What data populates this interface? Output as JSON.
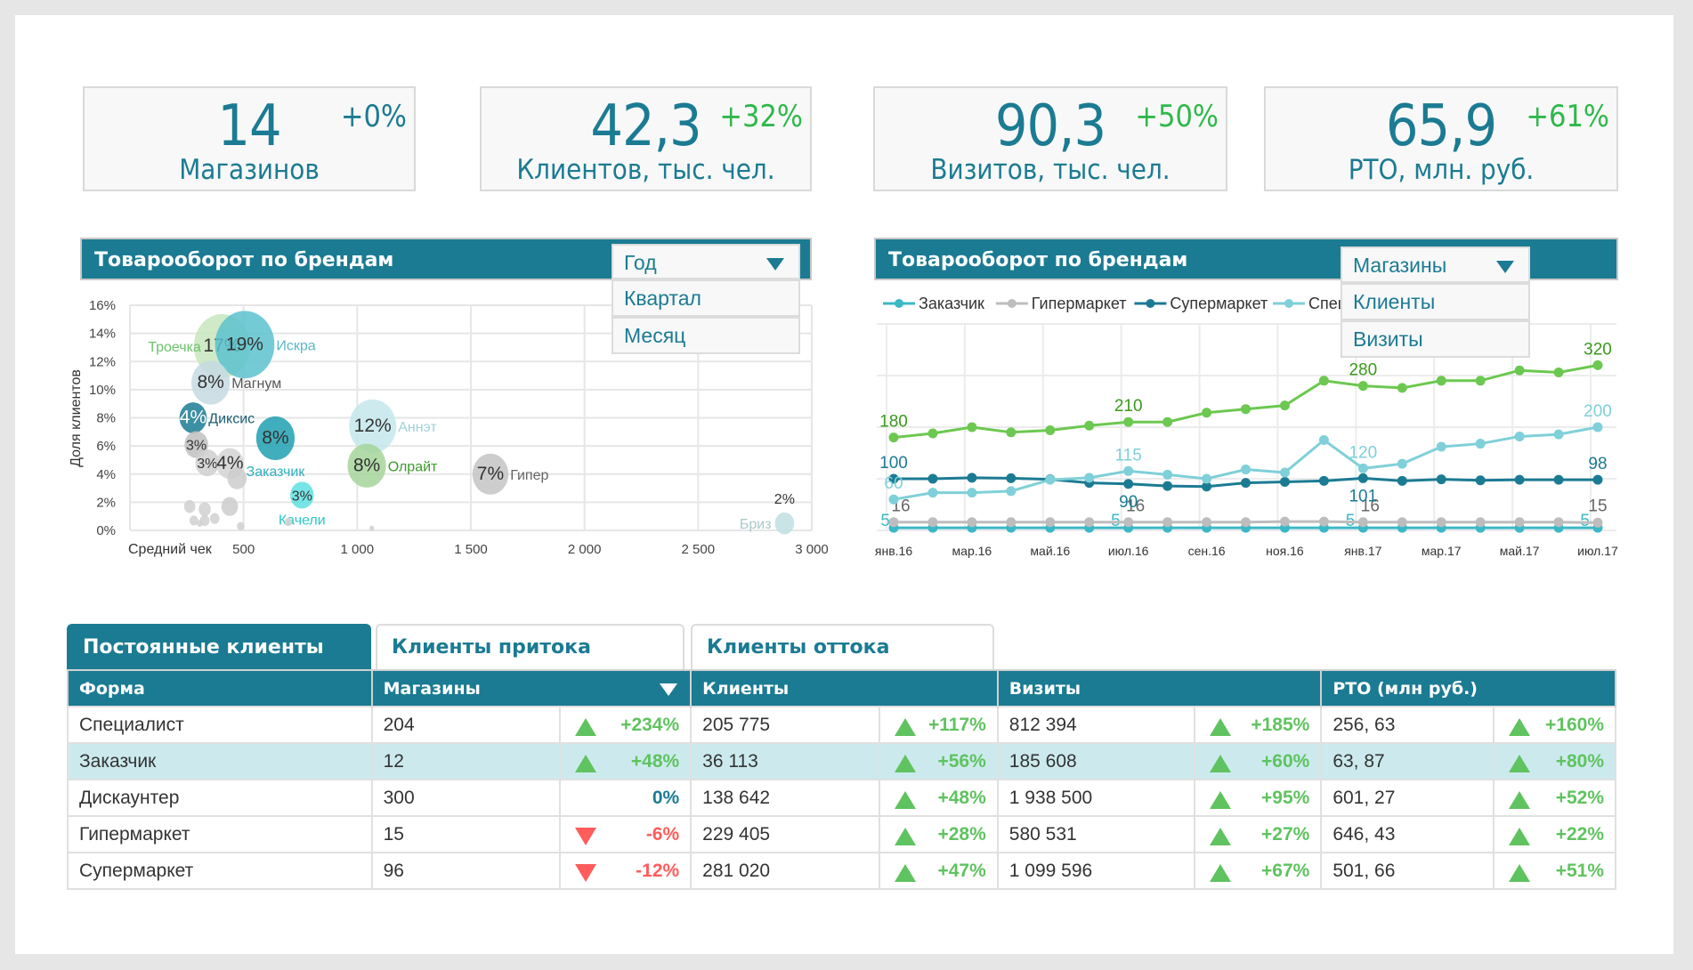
{
  "kpis": [
    {
      "value": "14",
      "change": "+0%",
      "label": "Магазинов",
      "change_color": "#1b7b93"
    },
    {
      "value": "42,3",
      "change": "+32%",
      "label": "Клиентов, тыс. чел.",
      "change_color": "#2fb84a"
    },
    {
      "value": "90,3",
      "change": "+50%",
      "label": "Визитов, тыс. чел.",
      "change_color": "#2fb84a"
    },
    {
      "value": "65,9",
      "change": "+61%",
      "label": "РТО, млн. руб.",
      "change_color": "#2fb84a"
    }
  ],
  "left_panel": {
    "title": "Товарооборот по брендам",
    "dropdown": {
      "selected": "Год",
      "options": [
        "Квартал",
        "Месяц"
      ]
    }
  },
  "right_panel": {
    "title": "Товарооборот по брендам",
    "dropdown": {
      "selected": "Магазины",
      "options": [
        "Клиенты",
        "Визиты"
      ]
    }
  },
  "chart_data": [
    {
      "type": "scatter",
      "subtype": "bubble",
      "xlabel": "Средний чек",
      "ylabel": "Доля клиентов",
      "xlim": [
        0,
        3000
      ],
      "ylim": [
        0,
        16
      ],
      "x_ticks": [
        "500",
        "1 000",
        "1 500",
        "2 000",
        "2 500",
        "3 000"
      ],
      "x_tick_values": [
        500,
        1000,
        1500,
        2000,
        2500,
        3000
      ],
      "y_ticks": [
        "0%",
        "2%",
        "4%",
        "6%",
        "8%",
        "10%",
        "12%",
        "14%",
        "16%"
      ],
      "grid": true,
      "points": [
        {
          "name": "Троечка",
          "x": 405,
          "y": 13.1,
          "size": 17,
          "label": "17%",
          "color": "#c8e6bd",
          "label_color": "#6cc36c"
        },
        {
          "name": "Искра",
          "x": 505,
          "y": 13.2,
          "size": 19,
          "label": "19%",
          "color": "#5cc2cf",
          "label_color": "#5ab8c8"
        },
        {
          "name": "Магнум",
          "x": 355,
          "y": 10.5,
          "size": 8,
          "label": "8%",
          "color": "#c6d9e2",
          "label_color": "#555555"
        },
        {
          "name": "Диксис",
          "x": 278,
          "y": 8.0,
          "size": 4,
          "label": "4%",
          "color": "#1b7b93",
          "label_color": "#1b5f72"
        },
        {
          "name": "",
          "x": 292,
          "y": 6.1,
          "size": 3,
          "label": "3%",
          "color": "#c0c0c0",
          "label_color": "#555555"
        },
        {
          "name": "",
          "x": 340,
          "y": 4.8,
          "size": 3,
          "label": "3%",
          "color": "#cfcfcf",
          "label_color": "#555555"
        },
        {
          "name": "",
          "x": 440,
          "y": 4.75,
          "size": 4,
          "label": "4%",
          "color": "#d4d4d4",
          "label_color": "#555555"
        },
        {
          "name": "",
          "x": 471,
          "y": 3.7,
          "size": 2,
          "label": "",
          "color": "#cccccc",
          "label_color": "#555555"
        },
        {
          "name": "Заказчик",
          "x": 640,
          "y": 6.55,
          "size": 8,
          "label": "8%",
          "color": "#1ea0b0",
          "label_color": "#30b0c0"
        },
        {
          "name": "Аннэт",
          "x": 1068,
          "y": 7.4,
          "size": 12,
          "label": "12%",
          "color": "#c4e7ec",
          "label_color": "#9fd2da"
        },
        {
          "name": "Олрайт",
          "x": 1042,
          "y": 4.6,
          "size": 8,
          "label": "8%",
          "color": "#a6d59a",
          "label_color": "#3a9a2a"
        },
        {
          "name": "Гипер",
          "x": 1586,
          "y": 4.0,
          "size": 7,
          "label": "7%",
          "color": "#c4c4c4",
          "label_color": "#666666"
        },
        {
          "name": "Качели",
          "x": 757,
          "y": 2.5,
          "size": 3,
          "label": "3%",
          "color": "#5fe0e0",
          "label_color": "#2cc8c8"
        },
        {
          "name": "Бриз",
          "x": 2880,
          "y": 0.5,
          "size": 2,
          "label": "2%",
          "color": "#c0dfe2",
          "label_color": "#aac8cc"
        },
        {
          "name": "",
          "x": 263,
          "y": 1.7,
          "size": 0.7,
          "label": "",
          "color": "#d0d0d0",
          "label_color": "#555555"
        },
        {
          "name": "",
          "x": 329,
          "y": 1.5,
          "size": 0.8,
          "label": "",
          "color": "#d0d0d0",
          "label_color": "#555555"
        },
        {
          "name": "",
          "x": 439,
          "y": 1.7,
          "size": 1.5,
          "label": "",
          "color": "#cccccc",
          "label_color": "#555555"
        },
        {
          "name": "",
          "x": 281,
          "y": 0.7,
          "size": 0.4,
          "label": "",
          "color": "#d0d0d0",
          "label_color": "#555555"
        },
        {
          "name": "",
          "x": 329,
          "y": 0.7,
          "size": 0.5,
          "label": "",
          "color": "#d0d0d0",
          "label_color": "#555555"
        },
        {
          "name": "",
          "x": 373,
          "y": 0.85,
          "size": 0.5,
          "label": "",
          "color": "#d0d0d0",
          "label_color": "#555555"
        },
        {
          "name": "",
          "x": 307,
          "y": 0.5,
          "size": 0.2,
          "label": "",
          "color": "#d0d0d0",
          "label_color": "#555555"
        },
        {
          "name": "",
          "x": 487,
          "y": 0.3,
          "size": 0.3,
          "label": "",
          "color": "#d0d0d0",
          "label_color": "#555555"
        },
        {
          "name": "",
          "x": 697,
          "y": 0.6,
          "size": 0.3,
          "label": "",
          "color": "#d0d0d0",
          "label_color": "#555555"
        },
        {
          "name": "",
          "x": 1064,
          "y": 0.15,
          "size": 0.1,
          "label": "",
          "color": "#d0d0d0",
          "label_color": "#555555"
        }
      ]
    },
    {
      "type": "line",
      "ylim": [
        0,
        400
      ],
      "grid": true,
      "legend": "top",
      "x_tick_labels": [
        "янв.16",
        "мар.16",
        "май.16",
        "июл.16",
        "сен.16",
        "ноя.16",
        "янв.17",
        "мар.17",
        "май.17",
        "июл.17"
      ],
      "series": [
        {
          "name": "Заказчик",
          "color": "#3bb8c6",
          "values": [
            5,
            5,
            5,
            5,
            5,
            5,
            5,
            5,
            5,
            5,
            5,
            5,
            5,
            5,
            5,
            5,
            5,
            5,
            5
          ],
          "labels": [
            {
              "i": 0,
              "text": "5"
            },
            {
              "i": 6,
              "text": "5"
            },
            {
              "i": 12,
              "text": "5"
            },
            {
              "i": 18,
              "text": "5"
            }
          ]
        },
        {
          "name": "Гипермаркет",
          "color": "#bdbdbd",
          "values": [
            16,
            16,
            16,
            16,
            16,
            16,
            16,
            16,
            16,
            16,
            17,
            17,
            16,
            16,
            16,
            16,
            16,
            16,
            15
          ],
          "labels": [
            {
              "i": 0,
              "text": "16"
            },
            {
              "i": 6,
              "text": "16"
            },
            {
              "i": 12,
              "text": "16"
            },
            {
              "i": 18,
              "text": "15"
            }
          ]
        },
        {
          "name": "Супермаркет",
          "color": "#1b7b93",
          "values": [
            100,
            100,
            102,
            101,
            99,
            92,
            90,
            86,
            85,
            92,
            94,
            96,
            101,
            96,
            99,
            97,
            98,
            98,
            98
          ],
          "labels": [
            {
              "i": 0,
              "text": "100"
            },
            {
              "i": 6,
              "text": "90"
            },
            {
              "i": 12,
              "text": "101"
            },
            {
              "i": 18,
              "text": "98"
            }
          ]
        },
        {
          "name": "Специалист",
          "color": "#7fd0d8",
          "values": [
            60,
            73,
            73,
            76,
            98,
            102,
            115,
            108,
            100,
            118,
            112,
            175,
            120,
            129,
            162,
            168,
            182,
            186,
            200
          ],
          "labels": [
            {
              "i": 0,
              "text": "60"
            },
            {
              "i": 6,
              "text": "115"
            },
            {
              "i": 12,
              "text": "120"
            },
            {
              "i": 18,
              "text": "200"
            }
          ]
        },
        {
          "name": "Дискаунтер",
          "color": "#6cc850",
          "values": [
            180,
            188,
            200,
            190,
            194,
            203,
            210,
            210,
            228,
            235,
            242,
            290,
            280,
            276,
            290,
            290,
            310,
            306,
            320
          ],
          "labels": [
            {
              "i": 0,
              "text": "180"
            },
            {
              "i": 6,
              "text": "210"
            },
            {
              "i": 12,
              "text": "280"
            },
            {
              "i": 18,
              "text": "320"
            }
          ]
        }
      ]
    }
  ],
  "tabs": [
    "Постоянные клиенты",
    "Клиенты притока",
    "Клиенты оттока"
  ],
  "table": {
    "headers": [
      "Форма",
      "Магазины",
      "Клиенты",
      "Визиты",
      "РТО (млн руб.)"
    ],
    "rows": [
      {
        "form": "Специалист",
        "cells": [
          [
            "204",
            "+234%",
            "up"
          ],
          [
            "205 775",
            "+117%",
            "up"
          ],
          [
            "812 394",
            "+185%",
            "up"
          ],
          [
            "256, 63",
            "+160%",
            "up"
          ]
        ]
      },
      {
        "form": "Заказчик",
        "cells": [
          [
            "12",
            "+48%",
            "up"
          ],
          [
            "36 113",
            "+56%",
            "up"
          ],
          [
            "185 608",
            "+60%",
            "up"
          ],
          [
            "63, 87",
            "+80%",
            "up"
          ]
        ]
      },
      {
        "form": "Дискаунтер",
        "cells": [
          [
            "300",
            "0%",
            "none"
          ],
          [
            "138 642",
            "+48%",
            "up"
          ],
          [
            "1 938 500",
            "+95%",
            "up"
          ],
          [
            "601, 27",
            "+52%",
            "up"
          ]
        ]
      },
      {
        "form": "Гипермаркет",
        "cells": [
          [
            "15",
            "-6%",
            "down"
          ],
          [
            "229 405",
            "+28%",
            "up"
          ],
          [
            "580 531",
            "+27%",
            "up"
          ],
          [
            "646, 43",
            "+22%",
            "up"
          ]
        ]
      },
      {
        "form": "Супермаркет",
        "cells": [
          [
            "96",
            "-12%",
            "down"
          ],
          [
            "281 020",
            "+47%",
            "up"
          ],
          [
            "1 099 596",
            "+67%",
            "up"
          ],
          [
            "501, 66",
            "+51%",
            "up"
          ]
        ]
      }
    ],
    "highlighted_row": 1,
    "colors": {
      "up": "#5fc35f",
      "down": "#ff5c5c",
      "none": "#1b7b93"
    }
  }
}
